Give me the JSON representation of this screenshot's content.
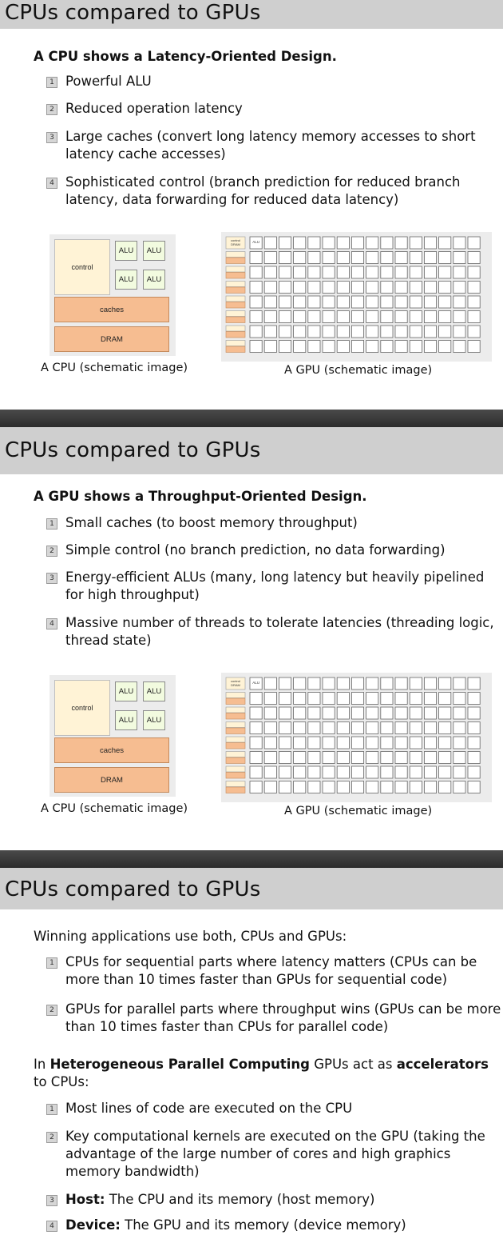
{
  "slides": [
    {
      "title": "CPUs compared to GPUs",
      "heading": "A CPU shows a Latency-Oriented Design.",
      "items": [
        {
          "num": "1",
          "text": "Powerful ALU"
        },
        {
          "num": "2",
          "text": "Reduced operation latency"
        },
        {
          "num": "3",
          "text": "Large caches (convert long latency memory accesses to short latency cache accesses)"
        },
        {
          "num": "4",
          "text": "Sophisticated control (branch prediction for reduced branch latency, data forwarding for reduced data latency)"
        }
      ],
      "cpu_caption": "A CPU (schematic image)",
      "gpu_caption": "A GPU (schematic image)"
    },
    {
      "title": "CPUs compared to GPUs",
      "heading": "A GPU shows a Throughput-Oriented Design.",
      "items": [
        {
          "num": "1",
          "text": "Small caches (to boost memory throughput)"
        },
        {
          "num": "2",
          "text": "Simple control (no branch prediction, no data forwarding)"
        },
        {
          "num": "3",
          "text": "Energy-efficient ALUs (many, long latency but heavily pipelined for high throughput)"
        },
        {
          "num": "4",
          "text": "Massive number of threads to tolerate latencies (threading logic, thread state)"
        }
      ],
      "cpu_caption": "A CPU (schematic image)",
      "gpu_caption": "A GPU (schematic image)"
    },
    {
      "title": "CPUs compared to GPUs",
      "intro": "Winning applications use both, CPUs and GPUs:",
      "items": [
        {
          "num": "1",
          "text": "CPUs for sequential parts where latency matters (CPUs can be more than 10 times faster than GPUs for sequential code)"
        },
        {
          "num": "2",
          "text": "GPUs for parallel parts where throughput wins (GPUs can be more than 10 times faster than CPUs for parallel code)"
        }
      ],
      "para2": {
        "pre": "In ",
        "bold1": "Heterogeneous Parallel Computing",
        "mid": " GPUs act as ",
        "bold2": "accelerators",
        "post": " to CPUs:"
      },
      "items2": [
        {
          "num": "1",
          "text": "Most lines of code are executed on the CPU"
        },
        {
          "num": "2",
          "text": "Key computational kernels are executed on the GPU (taking the advantage of the large number of cores and high graphics memory bandwidth)"
        },
        {
          "num": "3",
          "label": "Host:",
          "text": " The CPU and its memory (host memory)"
        },
        {
          "num": "4",
          "label": "Device:",
          "text": " The GPU and its memory (device memory)"
        }
      ]
    }
  ],
  "diagram": {
    "cpu": {
      "control": "control",
      "alu": "ALU",
      "caches": "caches",
      "dram": "DRAM"
    },
    "gpu": {
      "control": "control",
      "dram": "DRAM",
      "alu": "ALU"
    }
  }
}
